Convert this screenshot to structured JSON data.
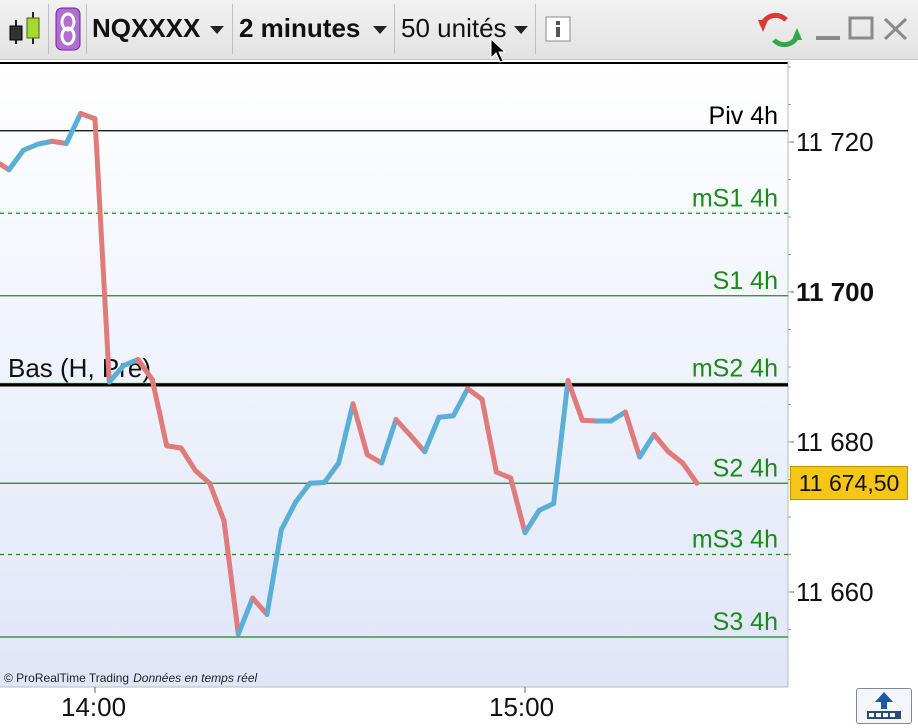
{
  "toolbar": {
    "symbol": "NQXXXX",
    "timeframe": "2 minutes",
    "units": "50 unités",
    "icons": [
      "candlestick-chart-icon",
      "link-icon",
      "info-icon",
      "refresh-icon",
      "minimize-icon",
      "maximize-icon",
      "close-icon"
    ]
  },
  "price_axis": {
    "ticks": [
      {
        "value": 11720,
        "label": "11 720",
        "bold": false
      },
      {
        "value": 11700,
        "label": "11 700",
        "bold": true
      },
      {
        "value": 11680,
        "label": "11 680",
        "bold": false
      },
      {
        "value": 11660,
        "label": "11 660",
        "bold": false
      }
    ],
    "current_price": "11 674,50"
  },
  "time_axis": {
    "ticks": [
      {
        "time": "14:00",
        "label": "14:00"
      },
      {
        "time": "15:00",
        "label": "15:00"
      }
    ]
  },
  "levels": [
    {
      "label": "Piv 4h",
      "price": 11721.5,
      "style": "solid",
      "color": "#000000"
    },
    {
      "label": "mS1 4h",
      "price": 11710.5,
      "style": "dashed",
      "color": "#1a8a1a"
    },
    {
      "label": "S1 4h",
      "price": 11699.5,
      "style": "solid",
      "color": "#1a8a1a"
    },
    {
      "label": "mS2 4h",
      "price": 11687.8,
      "style": "solid",
      "color": "#1a8a1a"
    },
    {
      "label": "S2 4h",
      "price": 11674.5,
      "style": "solid",
      "color": "#1a8a1a"
    },
    {
      "label": "mS3 4h",
      "price": 11665.0,
      "style": "dashed",
      "color": "#1a8a1a"
    },
    {
      "label": "S3 4h",
      "price": 11654.0,
      "style": "solid",
      "color": "#1a8a1a"
    }
  ],
  "bas_line": {
    "label": "Bas (H, Pré)",
    "price": 11687.6
  },
  "watermark": {
    "brand": "© ProRealTime Trading",
    "realtime": "Données en temps réel"
  },
  "colors": {
    "up": "#5aafd6",
    "down": "#df7b7b",
    "level_green": "#1a8a1a",
    "price_badge": "#f5c518",
    "bg_top": "#ffffff",
    "bg_bottom": "#dfe6f8"
  },
  "chart_data": {
    "type": "line",
    "title": "",
    "xlabel": "",
    "ylabel": "",
    "ylim": [
      11647,
      11731
    ],
    "series": [
      {
        "values": [
          {
            "t": "13:46",
            "p": 11717.5
          },
          {
            "t": "13:48",
            "p": 11716.3
          },
          {
            "t": "13:50",
            "p": 11718.9
          },
          {
            "t": "13:52",
            "p": 11719.7
          },
          {
            "t": "13:54",
            "p": 11720.1
          },
          {
            "t": "13:56",
            "p": 11719.8
          },
          {
            "t": "13:58",
            "p": 11723.8
          },
          {
            "t": "14:00",
            "p": 11723.1
          },
          {
            "t": "14:02",
            "p": 11688.0
          },
          {
            "t": "14:04",
            "p": 11690.2
          },
          {
            "t": "14:06",
            "p": 11691.0
          },
          {
            "t": "14:08",
            "p": 11688.3
          },
          {
            "t": "14:10",
            "p": 11679.5
          },
          {
            "t": "14:12",
            "p": 11679.2
          },
          {
            "t": "14:14",
            "p": 11676.2
          },
          {
            "t": "14:16",
            "p": 11674.5
          },
          {
            "t": "14:18",
            "p": 11669.5
          },
          {
            "t": "14:20",
            "p": 11654.4
          },
          {
            "t": "14:22",
            "p": 11659.2
          },
          {
            "t": "14:24",
            "p": 11657.0
          },
          {
            "t": "14:26",
            "p": 11668.3
          },
          {
            "t": "14:28",
            "p": 11672.0
          },
          {
            "t": "14:30",
            "p": 11674.5
          },
          {
            "t": "14:32",
            "p": 11674.6
          },
          {
            "t": "14:34",
            "p": 11677.2
          },
          {
            "t": "14:36",
            "p": 11685.1
          },
          {
            "t": "14:38",
            "p": 11678.3
          },
          {
            "t": "14:40",
            "p": 11677.2
          },
          {
            "t": "14:42",
            "p": 11683.0
          },
          {
            "t": "14:44",
            "p": 11680.9
          },
          {
            "t": "14:46",
            "p": 11678.7
          },
          {
            "t": "14:48",
            "p": 11683.3
          },
          {
            "t": "14:50",
            "p": 11683.5
          },
          {
            "t": "14:52",
            "p": 11687.1
          },
          {
            "t": "14:54",
            "p": 11685.7
          },
          {
            "t": "14:56",
            "p": 11676.0
          },
          {
            "t": "14:58",
            "p": 11675.2
          },
          {
            "t": "15:00",
            "p": 11667.9
          },
          {
            "t": "15:02",
            "p": 11670.9
          },
          {
            "t": "15:04",
            "p": 11671.8
          },
          {
            "t": "15:06",
            "p": 11688.2
          },
          {
            "t": "15:08",
            "p": 11682.9
          },
          {
            "t": "15:10",
            "p": 11682.8
          },
          {
            "t": "15:12",
            "p": 11682.8
          },
          {
            "t": "15:14",
            "p": 11684.0
          },
          {
            "t": "15:16",
            "p": 11678.0
          },
          {
            "t": "15:18",
            "p": 11681.0
          },
          {
            "t": "15:20",
            "p": 11678.7
          },
          {
            "t": "15:22",
            "p": 11677.2
          },
          {
            "t": "15:24",
            "p": 11674.5
          }
        ]
      }
    ]
  }
}
